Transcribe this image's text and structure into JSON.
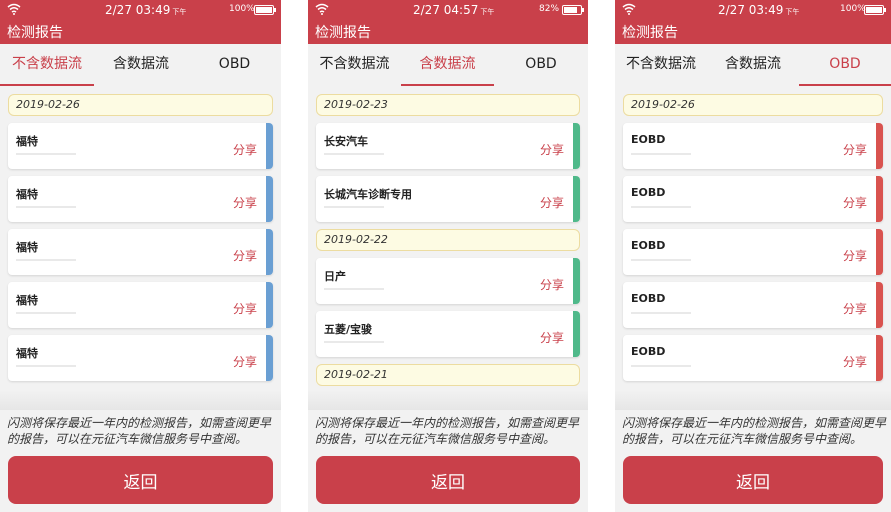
{
  "colors": {
    "primary": "#c9404a",
    "tab_active": "#c9404a",
    "accent_blue": "#6a9fd3",
    "accent_green": "#4fb98a",
    "accent_red": "#d9534f",
    "chip_bg": "#fdfbe3"
  },
  "screens": [
    {
      "status": {
        "time": "2/27  03:49",
        "ampm": "下午",
        "battery": "100%",
        "battery_level": 1.0
      },
      "title": "检测报告",
      "tabs": [
        "不含数据流",
        "含数据流",
        "OBD"
      ],
      "active_tab": 0,
      "accent_color": "#6a9fd3",
      "groups": [
        {
          "date": "2019-02-26",
          "items": [
            {
              "brand": "福特",
              "action": "分享"
            },
            {
              "brand": "福特",
              "action": "分享"
            },
            {
              "brand": "福特",
              "action": "分享"
            },
            {
              "brand": "福特",
              "action": "分享"
            },
            {
              "brand": "福特",
              "action": "分享"
            }
          ]
        }
      ],
      "notice": "闪测将保存最近一年内的检测报告，如需查阅更早的报告，可以在元征汽车微信服务号中查阅。",
      "back_label": "返回"
    },
    {
      "status": {
        "time": "2/27  04:57",
        "ampm": "下午",
        "battery": "82%",
        "battery_level": 0.82
      },
      "title": "检测报告",
      "tabs": [
        "不含数据流",
        "含数据流",
        "OBD"
      ],
      "active_tab": 1,
      "accent_color": "#4fb98a",
      "groups": [
        {
          "date": "2019-02-23",
          "items": [
            {
              "brand": "长安汽车",
              "action": "分享"
            },
            {
              "brand": "长城汽车诊断专用",
              "action": "分享"
            }
          ]
        },
        {
          "date": "2019-02-22",
          "items": [
            {
              "brand": "日产",
              "action": "分享"
            },
            {
              "brand": "五菱/宝骏",
              "action": "分享"
            }
          ]
        },
        {
          "date": "2019-02-21",
          "items": []
        }
      ],
      "notice": "闪测将保存最近一年内的检测报告，如需查阅更早的报告，可以在元征汽车微信服务号中查阅。",
      "back_label": "返回"
    },
    {
      "status": {
        "time": "2/27  03:49",
        "ampm": "下午",
        "battery": "100%",
        "battery_level": 1.0
      },
      "title": "检测报告",
      "tabs": [
        "不含数据流",
        "含数据流",
        "OBD"
      ],
      "active_tab": 2,
      "accent_color": "#d9534f",
      "groups": [
        {
          "date": "2019-02-26",
          "items": [
            {
              "brand": "EOBD",
              "action": "分享"
            },
            {
              "brand": "EOBD",
              "action": "分享"
            },
            {
              "brand": "EOBD",
              "action": "分享"
            },
            {
              "brand": "EOBD",
              "action": "分享"
            },
            {
              "brand": "EOBD",
              "action": "分享"
            }
          ]
        }
      ],
      "notice": "闪测将保存最近一年内的检测报告，如需查阅更早的报告，可以在元征汽车微信服务号中查阅。",
      "back_label": "返回"
    }
  ]
}
